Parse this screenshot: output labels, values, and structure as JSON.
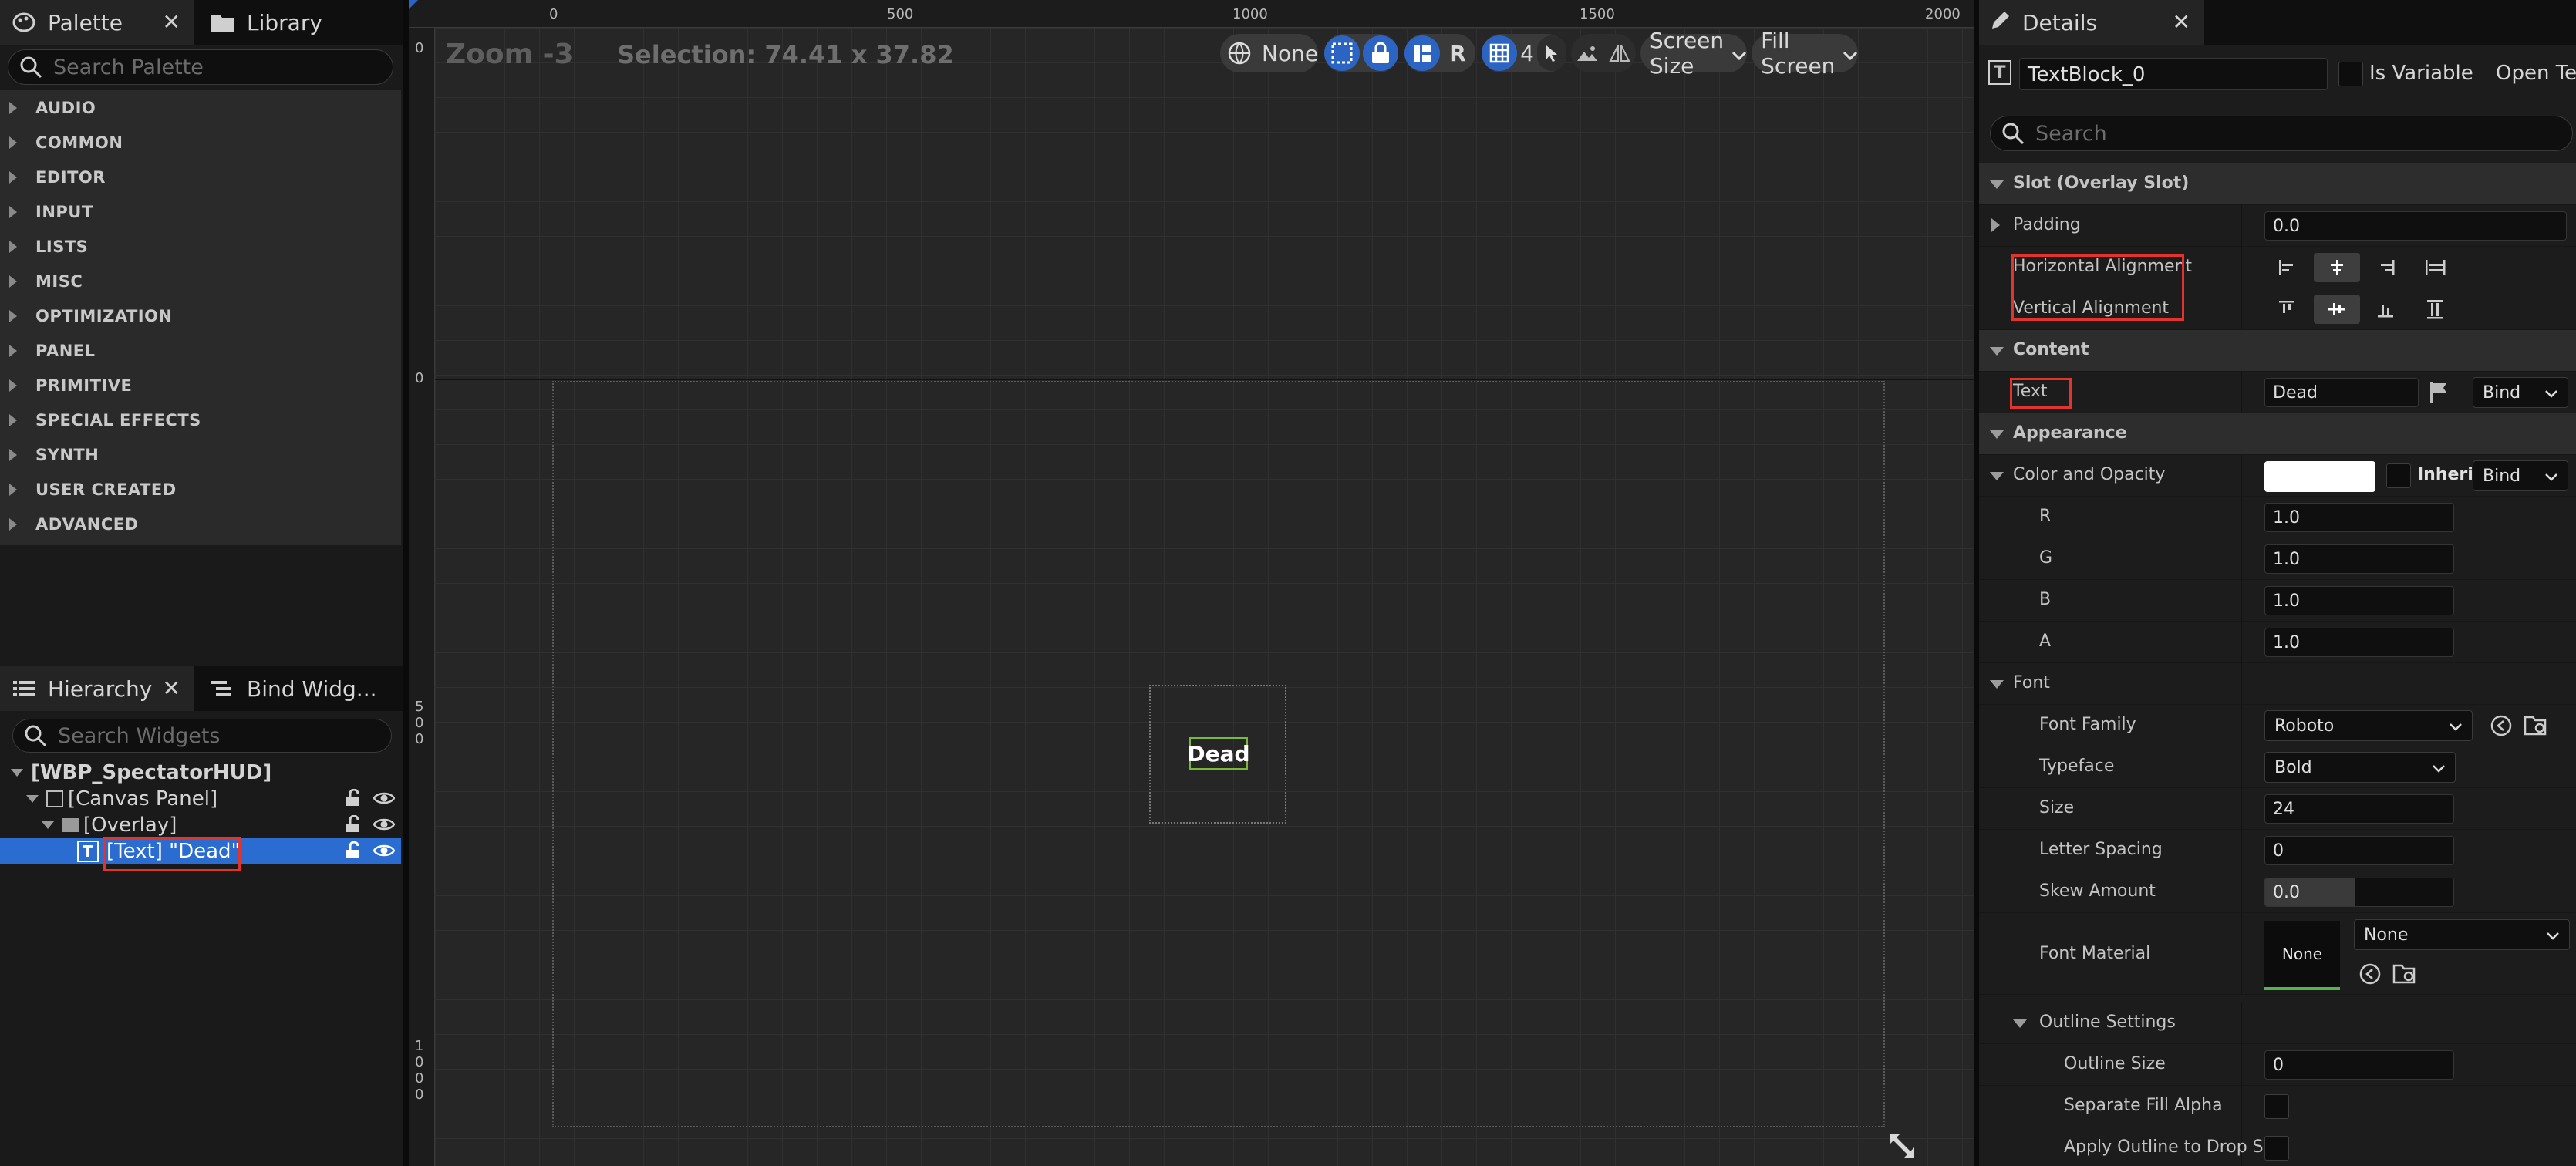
{
  "palette": {
    "tab_label": "Palette",
    "library_tab_label": "Library",
    "search_placeholder": "Search Palette",
    "categories": [
      "AUDIO",
      "COMMON",
      "EDITOR",
      "INPUT",
      "LISTS",
      "MISC",
      "OPTIMIZATION",
      "PANEL",
      "PRIMITIVE",
      "SPECIAL EFFECTS",
      "SYNTH",
      "USER CREATED",
      "ADVANCED"
    ]
  },
  "hierarchy": {
    "tab_label": "Hierarchy",
    "bind_tab_label": "Bind Widg...",
    "search_placeholder": "Search Widgets",
    "root_label": "[WBP_SpectatorHUD]",
    "nodes": [
      {
        "label": "[Canvas Panel]"
      },
      {
        "label": "[Overlay]"
      },
      {
        "label": "[Text] \"Dead\""
      }
    ]
  },
  "canvas": {
    "zoom_label": "Zoom -3",
    "selection_label": "Selection: 74.41 x 37.82",
    "ruler_top": [
      "0",
      "500",
      "1000",
      "1500",
      "2000"
    ],
    "ruler_left": [
      "0",
      "0",
      "5\n0\n0",
      "1\n0\n0\n0"
    ],
    "toolbar": {
      "none_label": "None",
      "r_label": "R",
      "grid_count": "4",
      "screen_size_label": "Screen Size",
      "fill_screen_label": "Fill Screen"
    },
    "widget_text": "Dead"
  },
  "details": {
    "tab_label": "Details",
    "widget_name": "TextBlock_0",
    "is_variable_label": "Is Variable",
    "open_text_label": "Open Tex",
    "search_placeholder": "Search",
    "sections": {
      "slot": "Slot (Overlay Slot)",
      "content": "Content",
      "appearance": "Appearance"
    },
    "padding_label": "Padding",
    "padding_value": "0.0",
    "h_align_label": "Horizontal Alignment",
    "v_align_label": "Vertical Alignment",
    "text_label": "Text",
    "text_value": "Dead",
    "bind_label": "Bind",
    "color_label": "Color and Opacity",
    "inherit_label": "Inherit",
    "rgba": [
      {
        "label": "R",
        "value": "1.0"
      },
      {
        "label": "G",
        "value": "1.0"
      },
      {
        "label": "B",
        "value": "1.0"
      },
      {
        "label": "A",
        "value": "1.0"
      }
    ],
    "font_label": "Font",
    "font_family_label": "Font Family",
    "font_family_value": "Roboto",
    "typeface_label": "Typeface",
    "typeface_value": "Bold",
    "size_label": "Size",
    "size_value": "24",
    "letter_spacing_label": "Letter Spacing",
    "letter_spacing_value": "0",
    "skew_label": "Skew Amount",
    "skew_value": "0.0",
    "font_material_label": "Font Material",
    "font_material_thumb": "None",
    "font_material_value": "None",
    "outline_settings_label": "Outline Settings",
    "outline_size_label": "Outline Size",
    "outline_size_value": "0",
    "separate_fill_alpha_label": "Separate Fill Alpha",
    "apply_outline_label": "Apply Outline to Drop S..."
  },
  "colors": {
    "accent": "#2a6cd0",
    "highlight": "#e0342e",
    "selection_green": "#78b83a"
  }
}
